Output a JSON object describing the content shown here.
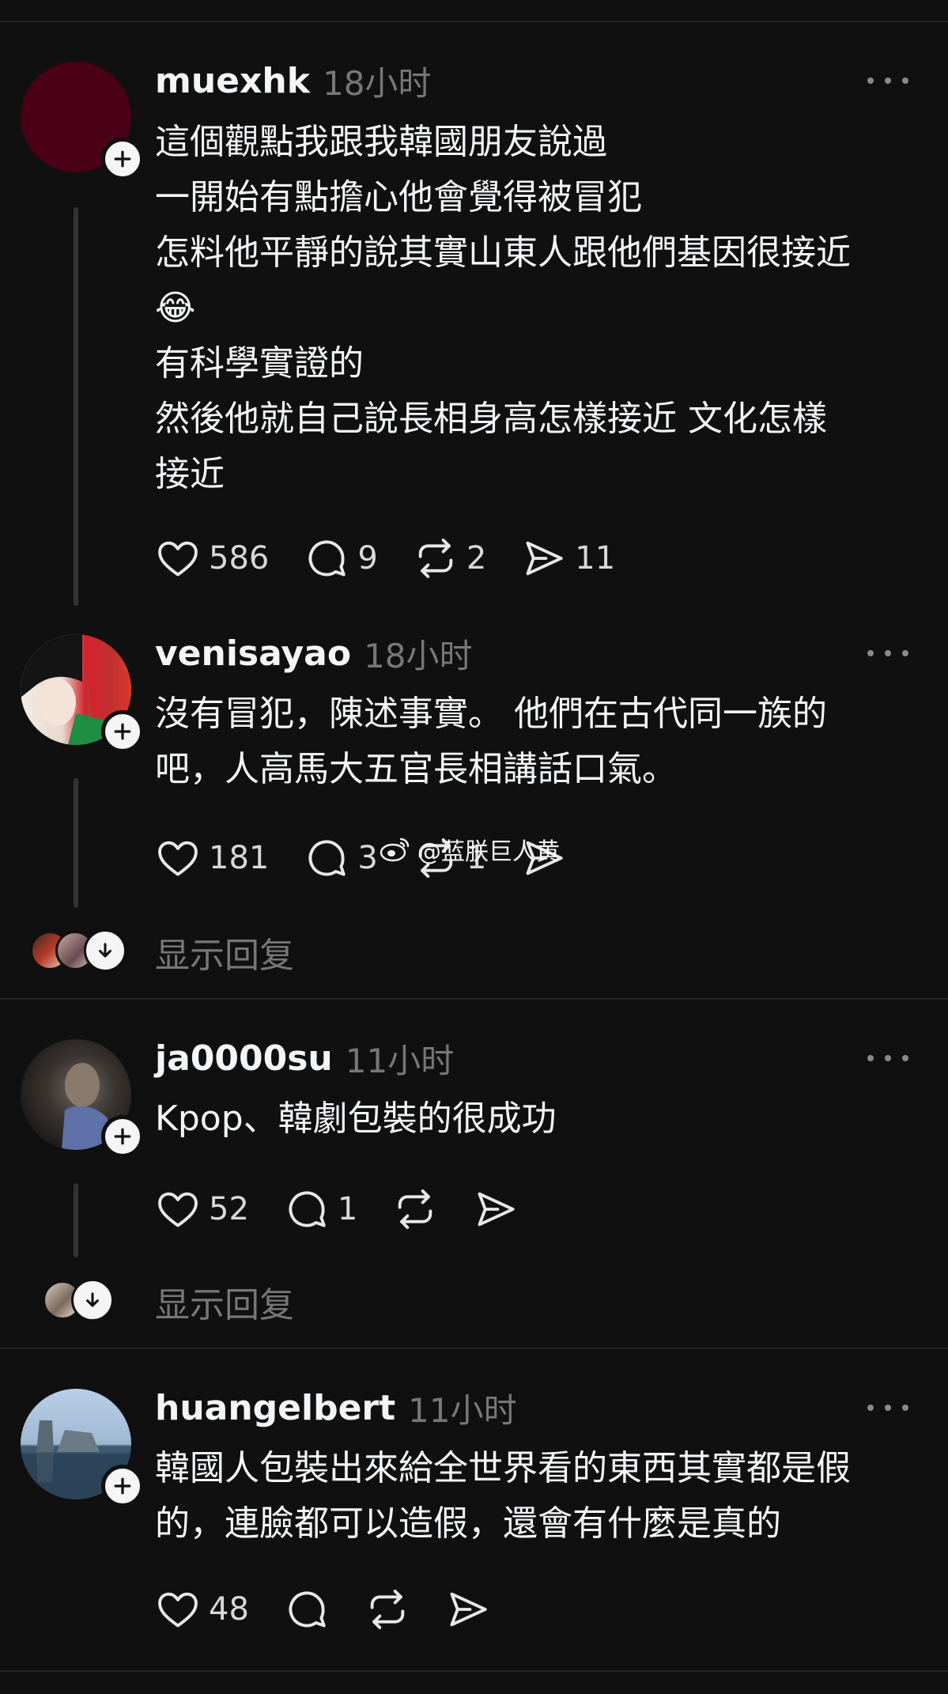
{
  "posts": [
    {
      "username": "muexhk",
      "time": "18小时",
      "avatar_color": "#4a0016",
      "lines": [
        "這個觀點我跟我韓國朋友說過",
        "一開始有點擔心他會覺得被冒犯",
        "怎料他平靜的說其實山東人跟他們基因很接近",
        "😂",
        "有科學實證的",
        "然後他就自己說長相身高怎樣接近 文化怎樣",
        "接近"
      ],
      "likes": "586",
      "comments": "9",
      "reposts": "2",
      "shares": "11"
    },
    {
      "username": "venisayao",
      "time": "18小时",
      "lines": [
        "沒有冒犯，陳述事實。 他們在古代同一族的",
        "吧，人高馬大五官長相講話口氣。"
      ],
      "likes": "181",
      "comments": "3",
      "reposts": "1",
      "shares": "",
      "show_replies": "显示回复"
    },
    {
      "username": "ja0000su",
      "time": "11小时",
      "lines": [
        "Kpop、韓劇包裝的很成功"
      ],
      "likes": "52",
      "comments": "1",
      "reposts": "",
      "shares": "",
      "show_replies": "显示回复"
    },
    {
      "username": "huangelbert",
      "time": "11小时",
      "lines": [
        "韓國人包裝出來給全世界看的東西其實都是假",
        "的，連臉都可以造假，還會有什麼是真的"
      ],
      "likes": "48",
      "comments": "",
      "reposts": "",
      "shares": ""
    }
  ],
  "watermark": "@蓝朕巨人黄",
  "icons": {
    "like": "heart-icon",
    "comment": "comment-bubble-icon",
    "repost": "repost-icon",
    "share": "share-send-icon",
    "more": "more-dots-icon",
    "follow": "plus-icon",
    "expand": "chevron-down-icon",
    "weibo": "weibo-logo-icon"
  }
}
